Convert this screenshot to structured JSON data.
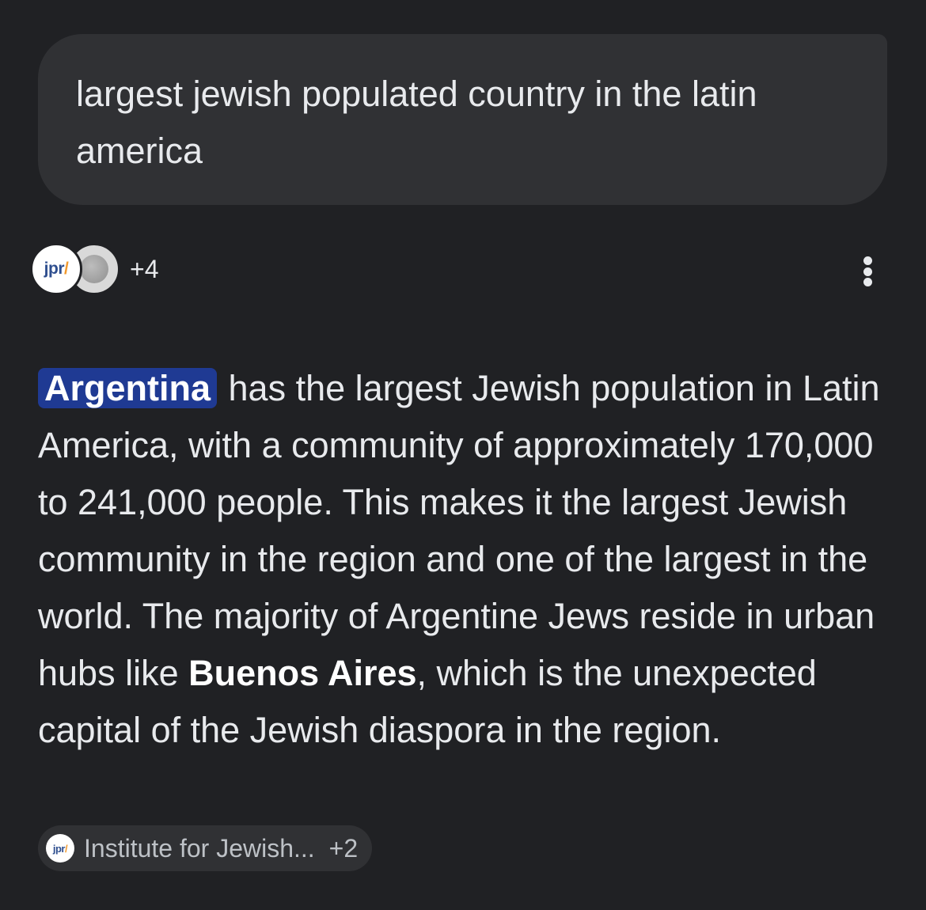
{
  "query": {
    "text": "largest jewish populated country in the latin america"
  },
  "sources": {
    "primary_favicon_label": "jpr",
    "secondary_favicon": "globe-icon",
    "more_count": "+4",
    "menu_icon": "more-vert-icon"
  },
  "answer": {
    "highlight": "Argentina",
    "part1": " has the largest Jewish population in Latin America, with a community of approximately 170,000 to 241,000 people. This makes it the largest Jewish community in the region and one of the largest in the world. The majority of Argentine Jews reside in urban hubs like ",
    "bold": "Buenos Aires",
    "part2": ", which is the unexpected capital of the Jewish diaspora in the region."
  },
  "citation": {
    "favicon_label": "jpr",
    "text": "Institute for Jewish...",
    "more_count": "+2"
  },
  "colors": {
    "background": "#202124",
    "bubble": "#303134",
    "highlight": "#1f3a93",
    "text": "#e8eaed"
  }
}
